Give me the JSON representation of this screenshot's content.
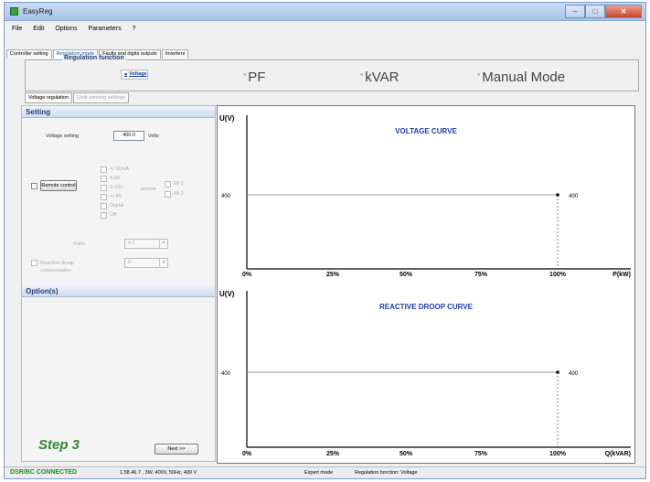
{
  "window": {
    "title": "EasyReg"
  },
  "menu": [
    "File",
    "Edit",
    "Options",
    "Parameters",
    "?"
  ],
  "tabs": [
    {
      "label": "Controller setting",
      "active": false
    },
    {
      "label": "Regulation mode",
      "active": true
    },
    {
      "label": "Faults and digits outputs",
      "active": false
    },
    {
      "label": "Inverters",
      "active": false
    }
  ],
  "regulation": {
    "legend": "Regulation function",
    "options": [
      {
        "label": "Voltage",
        "selected": true
      },
      {
        "label": "PF",
        "selected": false
      },
      {
        "label": "kVAR",
        "selected": false
      },
      {
        "label": "Manual Mode",
        "selected": false
      }
    ]
  },
  "subtabs": [
    {
      "label": "Voltage regulation",
      "enabled": true
    },
    {
      "label": "Limit sensing settings",
      "enabled": false
    }
  ],
  "setting": {
    "header": "Setting",
    "voltage_label": "Voltage setting",
    "voltage_value": "400.0",
    "voltage_unit": "Volts",
    "remote_label": "Remote control",
    "remote_options_left": [
      "+/-10mA",
      "4-20",
      "0-10V",
      "+/-5V",
      "Digital",
      "Off"
    ],
    "remote_options_right": [
      "Mt 1",
      "Mt 2"
    ],
    "remote_mid": "remote",
    "ratio_label": "Ratio",
    "ratio_value": "4.3",
    "reactive_label": "Reactive droop compensation",
    "reactive_value": "0"
  },
  "options_header": "Option(s)",
  "step": "Step 3",
  "next_button": "Next >>",
  "charts": [
    {
      "title": "VOLTAGE CURVE",
      "ylabel": "U(V)",
      "xlabel": "P(kW)",
      "x_ticks": [
        "0%",
        "25%",
        "50%",
        "75%",
        "100%"
      ],
      "level_left": "400",
      "level_right": "400"
    },
    {
      "title": "REACTIVE DROOP CURVE",
      "ylabel": "U(V)",
      "xlabel": "Q(kVAR)",
      "x_ticks": [
        "0%",
        "25%",
        "50%",
        "75%",
        "100%"
      ],
      "level_left": "400",
      "level_right": "400"
    }
  ],
  "status": {
    "connection": "DSR/BC CONNECTED",
    "device": "1.58.46.7 , 3W, 400V, 50Hz, 400 V",
    "mode": "Expert mode",
    "function": "Regulation function: Voltage"
  },
  "colors": {
    "accent": "#1a3fa8",
    "step": "#2f8a2f",
    "connected": "#1f8f1f"
  }
}
